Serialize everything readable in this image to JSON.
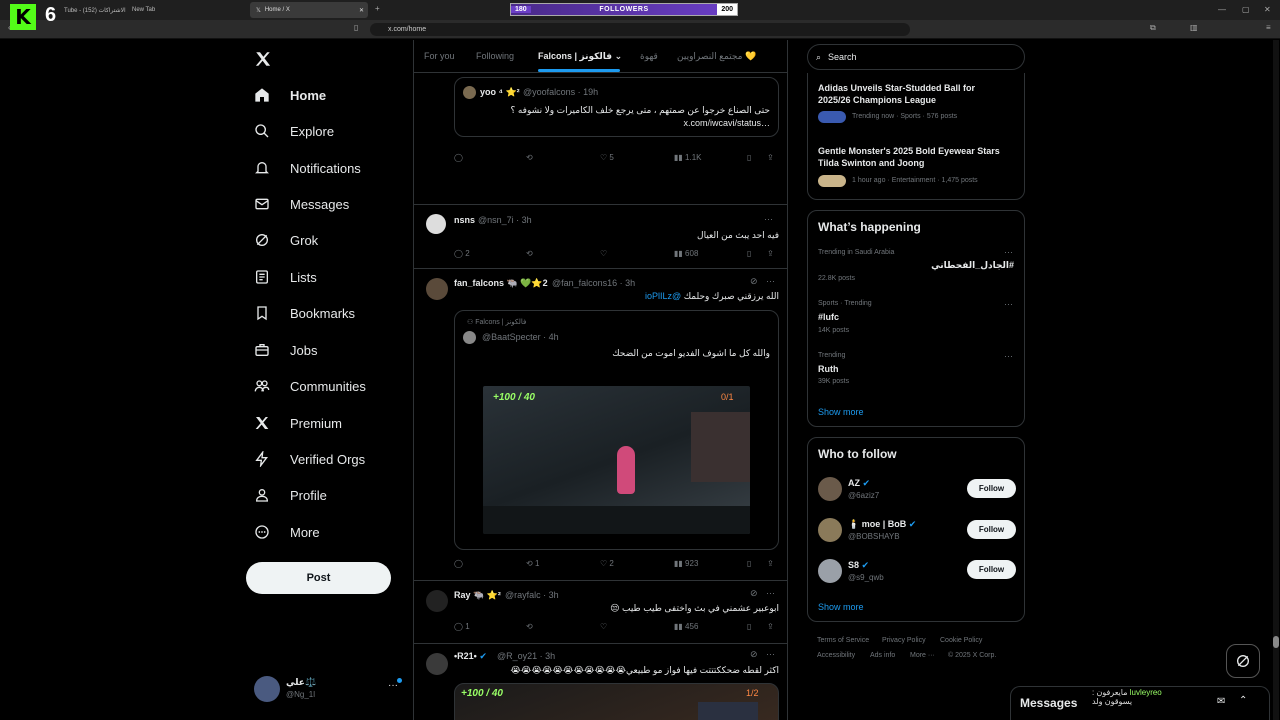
{
  "browser": {
    "tabs": [
      {
        "label": "Tube - الاشتراكات (152)",
        "active": false
      },
      {
        "label": "New Tab",
        "active": false
      },
      {
        "label": "Home / X",
        "active": true
      }
    ],
    "url": "x.com/home"
  },
  "overlay": {
    "kick_count": "6",
    "followers_label": "FOLLOWERS",
    "followers_current": "180",
    "followers_goal": "200",
    "chat_user": "luvleyreo",
    "chat_line1": "مايعرفون :",
    "chat_line2": "يسوقون ولد"
  },
  "nav": {
    "items": [
      {
        "label": "Home",
        "icon": "home-icon"
      },
      {
        "label": "Explore",
        "icon": "search-icon"
      },
      {
        "label": "Notifications",
        "icon": "bell-icon"
      },
      {
        "label": "Messages",
        "icon": "envelope-icon"
      },
      {
        "label": "Grok",
        "icon": "grok-icon"
      },
      {
        "label": "Lists",
        "icon": "list-icon"
      },
      {
        "label": "Bookmarks",
        "icon": "bookmark-icon"
      },
      {
        "label": "Jobs",
        "icon": "briefcase-icon"
      },
      {
        "label": "Communities",
        "icon": "people-icon"
      },
      {
        "label": "Premium",
        "icon": "x-logo-icon"
      },
      {
        "label": "Verified Orgs",
        "icon": "lightning-icon"
      },
      {
        "label": "Profile",
        "icon": "person-icon"
      },
      {
        "label": "More",
        "icon": "more-circle-icon"
      }
    ],
    "post_label": "Post",
    "account_name": "علي⚖️",
    "account_handle": "@Ng_1l"
  },
  "feed": {
    "tabs": [
      "For you",
      "Following",
      "Falcons | فالكونز",
      "قهوة",
      "مجتمع النصراويين 💛"
    ],
    "tweets": [
      {
        "quote_name": "yoo ⁴ ⭐²",
        "quote_handle": "@yoofalcons · 19h",
        "quote_text1": "حتى الصناع خرجوا عن صمتهم ، متى يرجع خلف الكاميرات ولا نشوفه ؟",
        "quote_text2": "x.com/iwcavi/status…",
        "replies": "",
        "reposts": "",
        "likes": "5",
        "views": "1.1K"
      },
      {
        "name": "nsns",
        "handle": "@nsn_7i · 3h",
        "text": "فيه احد يبث من العيال",
        "replies": "2",
        "reposts": "",
        "likes": "",
        "views": "608"
      },
      {
        "name": "fan_falcons 🐃 💚⭐2",
        "handle": "@fan_falcons16 · 3h",
        "text": "الله يرزقني صبرك وحلمك",
        "mention": "@ioPlILz",
        "quote_header": "Falcons | فالكونز",
        "quote_handle": "@BaatSpecter · 4h",
        "quote_text": "والله كل ما اشوف الفديو اموت من الضحك",
        "video_hud_left": "+100 / 40",
        "video_hud_right": "0/1",
        "replies": "",
        "reposts": "1",
        "likes": "2",
        "views": "923"
      },
      {
        "name": "Ray 🐃 ⭐²",
        "handle": "@rayfalc · 3h",
        "text": "ابوعبير عشمني في بث واختفى طيب طيب 😒",
        "replies": "1",
        "reposts": "",
        "likes": "",
        "views": "456"
      },
      {
        "name": "•R21•",
        "handle": "@R_oy21 · 3h",
        "text": "اكثر لقطه ضحككتتتت فيها فواز مو طبيعي😭😭😭😭😭😭😭😭😭😭😭",
        "video_hud_left": "+100 / 40",
        "video_hud_right": "1/2"
      }
    ]
  },
  "sidebar": {
    "search_placeholder": "Search",
    "trends_top": [
      {
        "title1": "Adidas Unveils Trending Star-Studded Ball for",
        "title": "Adidas Unveils Star-Studded Ball for",
        "title_line2": "2025/26 Champions League",
        "meta": "Trending now · Sports · 576 posts"
      },
      {
        "title": "Gentle Monster's 2025 Bold Eyewear Stars",
        "title_line2": "Tilda Swinton and Joong",
        "meta": "1 hour ago · Entertainment · 1,475 posts"
      }
    ],
    "happening_title": "What’s happening",
    "happening": [
      {
        "context": "Trending in Saudi Arabia",
        "title": "#الجادل_الفحطاني",
        "posts": "22.8K posts"
      },
      {
        "context": "Sports · Trending",
        "title": "#lufc",
        "posts": "14K posts"
      },
      {
        "context": "Trending",
        "title": "Ruth",
        "posts": "39K posts"
      }
    ],
    "show_more": "Show more",
    "who_title": "Who to follow",
    "who": [
      {
        "name": "AZ",
        "handle": "@6aziz7",
        "follow": "Follow"
      },
      {
        "name": "🕯️ moe | BoB",
        "handle": "@BOBSHAYB",
        "follow": "Follow"
      },
      {
        "name": "S8",
        "handle": "@s9_qwb",
        "follow": "Follow"
      }
    ],
    "footer": [
      "Terms of Service",
      "Privacy Policy",
      "Cookie Policy",
      "Accessibility",
      "Ads info",
      "More ···",
      "© 2025 X Corp."
    ],
    "messages_label": "Messages"
  },
  "colors": {
    "accent": "#1d9bf0",
    "bg": "#000000",
    "border": "#2f3336",
    "muted": "#71767b"
  }
}
